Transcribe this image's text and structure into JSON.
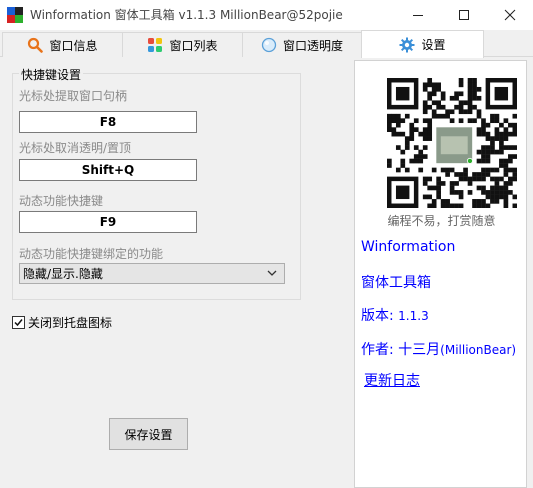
{
  "window": {
    "title": "Winformation 窗体工具箱 v1.1.3  MillionBear@52pojie"
  },
  "tabs": [
    {
      "label": "窗口信息",
      "icon": "magnifier-icon"
    },
    {
      "label": "窗口列表",
      "icon": "colored-blocks-icon"
    },
    {
      "label": "窗口透明度",
      "icon": "transparency-circle-icon"
    },
    {
      "label": "设置",
      "icon": "gear-icon",
      "active": true
    }
  ],
  "hotkeys": {
    "group_title": "快捷键设置",
    "extract_handle_label": "光标处提取窗口句柄",
    "extract_handle_value": "F8",
    "cancel_transparent_label": "光标处取消透明/置顶",
    "cancel_transparent_value": "Shift+Q",
    "dynamic_hotkey_label": "动态功能快捷键",
    "dynamic_hotkey_value": "F9",
    "dynamic_function_label": "动态功能快捷键绑定的功能",
    "dynamic_function_selected": "隐藏/显示.隐藏"
  },
  "tray": {
    "label": "关闭到托盘图标",
    "checked": true
  },
  "save_label": "保存设置",
  "about": {
    "qr_caption": "编程不易，打赏随意",
    "app_name": "Winformation",
    "app_subtitle": "窗体工具箱",
    "version_label": "版本:",
    "version_value": "1.1.3",
    "author_label": "作者: 十三月",
    "author_value": "(MillionBear)",
    "changelog_link": "更新日志"
  },
  "colors": {
    "link_blue": "#0000ff",
    "tab_active_bg": "#ffffff",
    "window_bg": "#f0f0f0"
  }
}
